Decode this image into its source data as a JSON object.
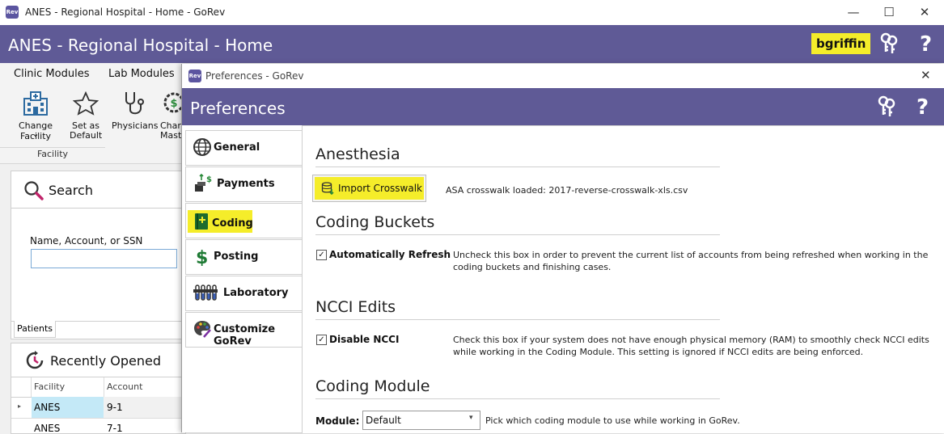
{
  "window": {
    "title": "ANES - Regional Hospital - Home - GoRev",
    "app_icon": "Rev",
    "minimize_glyph": "—",
    "maximize_glyph": "☐",
    "close_glyph": "✕"
  },
  "header": {
    "title": "ANES - Regional Hospital - Home",
    "username": "bgriffin",
    "help": "?"
  },
  "ribbon": {
    "tabs": [
      "Clinic Modules",
      "Lab Modules"
    ],
    "buttons": [
      {
        "line1": "Change Facility",
        "line2": "⌄"
      },
      {
        "line1": "Set as",
        "line2": "Default"
      },
      {
        "line1": "Physicians",
        "line2": ""
      },
      {
        "line1": "Charg",
        "line2": "Maste"
      }
    ],
    "group_label": "Facility"
  },
  "search": {
    "title": "Search",
    "field_label": "Name, Account, or SSN",
    "value": "",
    "tab": "Patients"
  },
  "recent": {
    "title": "Recently Opened",
    "columns": [
      "Facility",
      "Account"
    ],
    "rows": [
      {
        "facility": "ANES",
        "account": "9-1"
      },
      {
        "facility": "ANES",
        "account": "7-1"
      }
    ]
  },
  "dialog": {
    "window_title": "Preferences - GoRev",
    "close_glyph": "✕",
    "heading": "Preferences",
    "help": "?",
    "nav": [
      {
        "label": "General",
        "icon": "globe-icon"
      },
      {
        "label": "Payments",
        "icon": "payments-icon"
      },
      {
        "label": "Coding",
        "icon": "coding-book-icon"
      },
      {
        "label": "Posting",
        "icon": "dollar-icon"
      },
      {
        "label": "Laboratory",
        "icon": "test-tubes-icon"
      },
      {
        "label": "Customize GoRev",
        "icon": "palette-icon"
      }
    ],
    "selected_nav": "Coding",
    "anesthesia": {
      "title": "Anesthesia",
      "import_button": "Import Crosswalk",
      "status": "ASA crosswalk loaded: 2017-reverse-crosswalk-xls.csv"
    },
    "coding_buckets": {
      "title": "Coding Buckets",
      "checkbox_label": "Automatically Refresh",
      "checked": true,
      "description": "Uncheck this box in order to prevent the current list of accounts from being refreshed when working in the coding buckets and finishing cases."
    },
    "ncci": {
      "title": "NCCI Edits",
      "checkbox_label": "Disable NCCI",
      "checked": true,
      "description": "Check this box if your system does not have enough physical memory (RAM) to smoothly check NCCI edits while working in the Coding Module. This setting is ignored if NCCI edits are being enforced."
    },
    "coding_module": {
      "title": "Coding Module",
      "module_label": "Module:",
      "module_value": "Default",
      "hint": "Pick which coding module to use while working in GoRev."
    }
  },
  "colors": {
    "header_bg": "#5f5a96",
    "highlight": "#f5ed2a",
    "selected_row": "#c4e9f7"
  }
}
